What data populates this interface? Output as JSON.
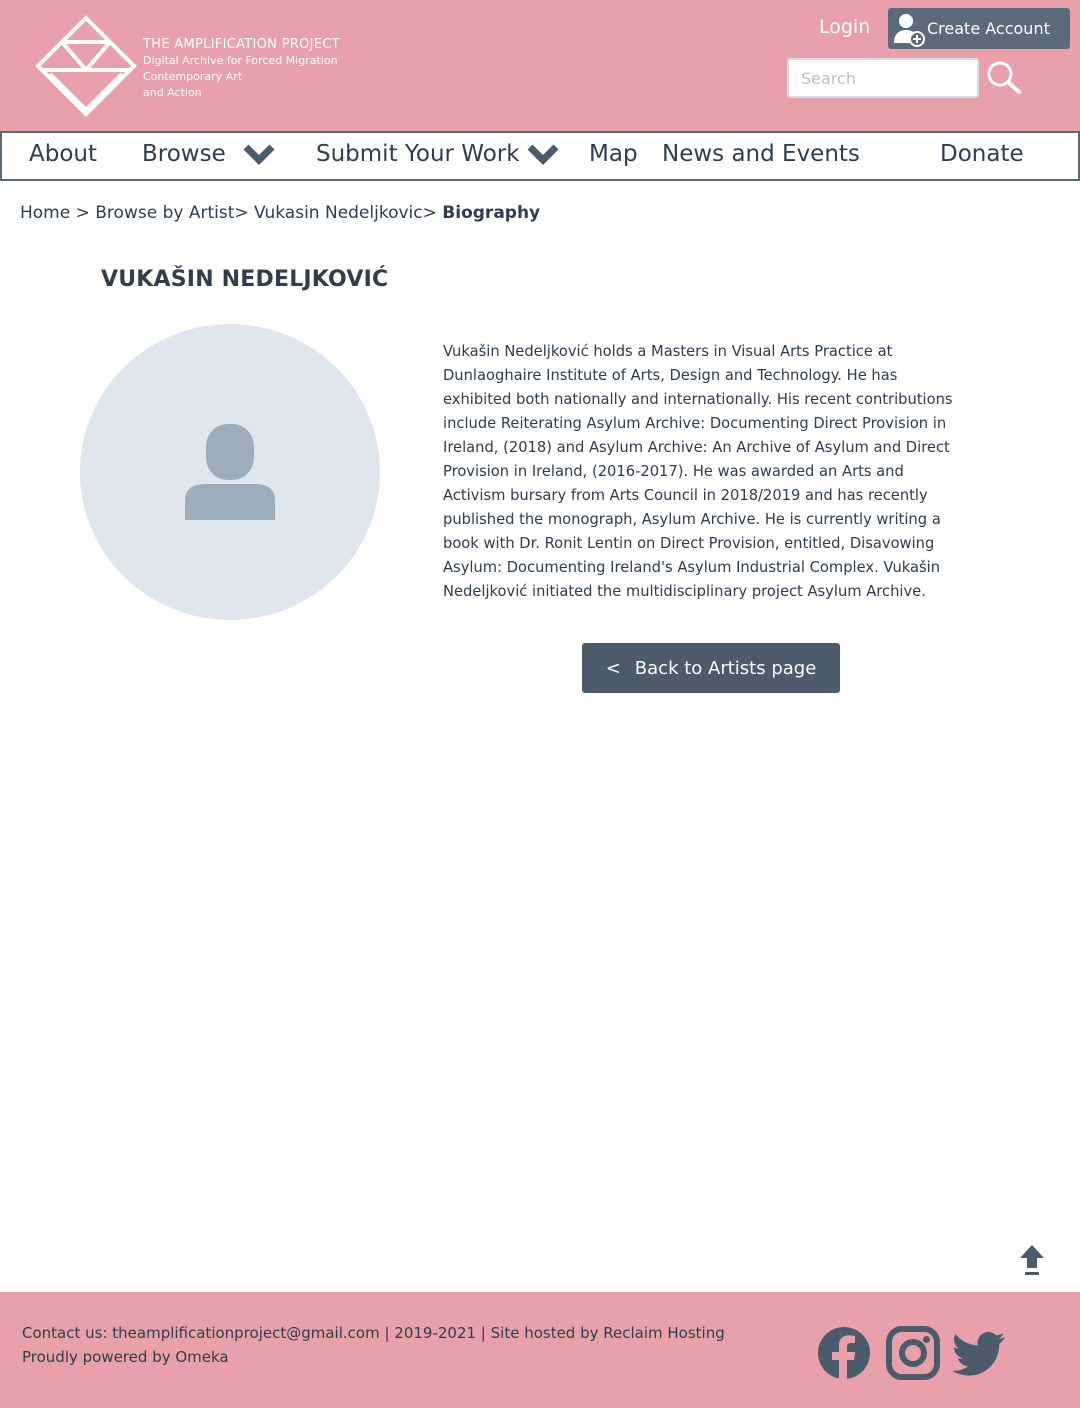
{
  "header": {
    "logo_title": "THE AMPLIFICATION PROJECT",
    "logo_sub1": "Digital Archive for Forced Migration",
    "logo_sub2": "Contemporary Art",
    "logo_sub3": "and Action",
    "login_label": "Login",
    "create_account_label": "Create Account",
    "search_placeholder": "Search"
  },
  "nav": {
    "items": [
      {
        "label": "About"
      },
      {
        "label": "Browse",
        "icon": "chevron-down-icon"
      },
      {
        "label": "Submit Your Work",
        "icon": "chevron-down-icon"
      },
      {
        "label": "Map"
      },
      {
        "label": "News and Events"
      },
      {
        "label": "Donate"
      }
    ]
  },
  "breadcrumb": {
    "home": "Home",
    "sep1": " > ",
    "browse": "Browse by Artist",
    "sep2": "> ",
    "artist": "Vukasin Nedeljkovic",
    "sep3": "> ",
    "current": "Biography"
  },
  "artist": {
    "name": "VUKAŠIN NEDELJKOVIĆ",
    "bio_lines": [
      "Vukašin Nedeljković holds a Masters in Visual Arts Practice at",
      "Dunlaoghaire Institute of Arts, Design and Technology. He has",
      "exhibited both nationally and internationally. His recent contributions",
      "include Reiterating Asylum Archive: Documenting Direct Provision in",
      "Ireland, (2018) and Asylum Archive: An Archive of Asylum and Direct",
      "Provision in Ireland, (2016-2017). He was awarded an Arts and",
      "Activism bursary from Arts Council in 2018/2019 and has recently",
      "published the monograph, Asylum Archive. He is currently writing a",
      "book with Dr. Ronit Lentin on Direct Provision, entitled, Disavowing",
      "Asylum: Documenting Ireland's Asylum Industrial Complex. Vukašin",
      "Nedeljković initiated the multidisciplinary project Asylum Archive."
    ],
    "back_prefix": "<",
    "back_label": "Back to Artists page"
  },
  "footer": {
    "line1": "Contact us: theamplificationproject@gmail.com | 2019-2021 | Site hosted by Reclaim Hosting",
    "line2": "Proudly powered by Omeka",
    "social_icons": [
      "facebook-icon",
      "instagram-icon",
      "twitter-icon"
    ]
  },
  "colors": {
    "brand_pink": "#e8a1aa",
    "slate": "#4b5b6b",
    "text": "#2f3d4d",
    "avatar_bg": "#e0e6ed",
    "avatar_figure": "#9eadbb"
  }
}
